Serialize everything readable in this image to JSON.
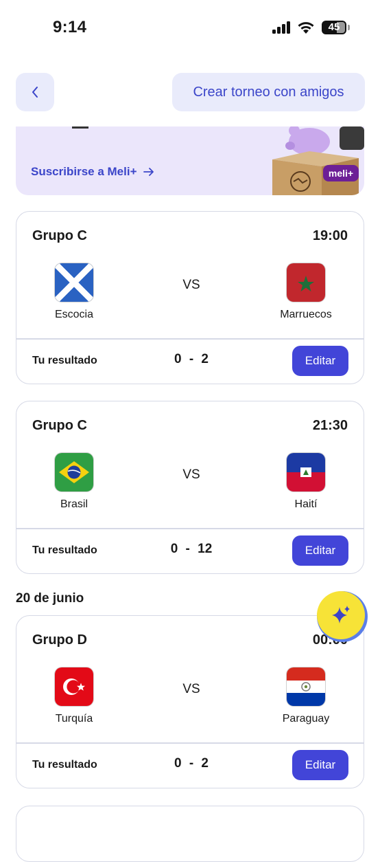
{
  "status_bar": {
    "time": "9:14",
    "battery": "45"
  },
  "header": {
    "back_icon": "chevron-left-icon",
    "tournament_button": "Crear torneo con amigos"
  },
  "promo": {
    "link_label": "Suscribirse a Meli+",
    "link_icon": "arrow-right-icon",
    "brand_badge": "meli+"
  },
  "matches": [
    {
      "group": "Grupo C",
      "time": "19:00",
      "home": "Escocia",
      "away": "Marruecos",
      "vs": "VS",
      "result_label": "Tu resultado",
      "score": "0 - 2",
      "edit_label": "Editar"
    },
    {
      "group": "Grupo C",
      "time": "21:30",
      "home": "Brasil",
      "away": "Haití",
      "vs": "VS",
      "result_label": "Tu resultado",
      "score": "0 - 12",
      "edit_label": "Editar"
    },
    {
      "group": "Grupo D",
      "time": "00:00",
      "home": "Turquía",
      "away": "Paraguay",
      "vs": "VS",
      "result_label": "Tu resultado",
      "score": "0 - 2",
      "edit_label": "Editar"
    }
  ],
  "date_heading": "20 de junio",
  "fab_icon": "sparkle-icon",
  "colors": {
    "accent": "#4245d8",
    "link": "#3b45c9",
    "soft_bg": "#e9ebfb",
    "promo_bg": "#ebe6fb",
    "fab": "#f7e337"
  }
}
